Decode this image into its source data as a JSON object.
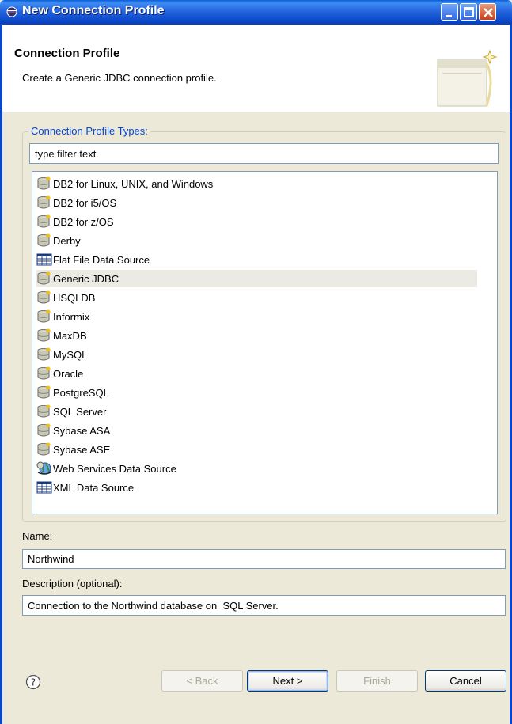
{
  "window": {
    "title": "New Connection Profile"
  },
  "banner": {
    "heading": "Connection Profile",
    "description": "Create a Generic JDBC connection profile."
  },
  "group": {
    "legend": "Connection Profile Types:",
    "filter_value": "type filter text",
    "items": [
      {
        "label": "DB2 for Linux, UNIX, and Windows",
        "icon": "database-icon"
      },
      {
        "label": "DB2 for i5/OS",
        "icon": "database-icon"
      },
      {
        "label": "DB2 for z/OS",
        "icon": "database-icon"
      },
      {
        "label": "Derby",
        "icon": "database-icon"
      },
      {
        "label": "Flat File Data Source",
        "icon": "table-icon"
      },
      {
        "label": "Generic JDBC",
        "icon": "database-icon",
        "selected": true
      },
      {
        "label": "HSQLDB",
        "icon": "database-icon"
      },
      {
        "label": "Informix",
        "icon": "database-icon"
      },
      {
        "label": "MaxDB",
        "icon": "database-icon"
      },
      {
        "label": "MySQL",
        "icon": "database-icon"
      },
      {
        "label": "Oracle",
        "icon": "database-icon"
      },
      {
        "label": "PostgreSQL",
        "icon": "database-icon"
      },
      {
        "label": "SQL Server",
        "icon": "database-icon"
      },
      {
        "label": "Sybase ASA",
        "icon": "database-icon"
      },
      {
        "label": "Sybase ASE",
        "icon": "database-icon"
      },
      {
        "label": "Web Services Data Source",
        "icon": "web-services-icon"
      },
      {
        "label": "XML Data Source",
        "icon": "table-icon"
      }
    ]
  },
  "form": {
    "name_label": "Name:",
    "name_value": "Northwind",
    "description_label": "Description (optional):",
    "description_value": "Connection to the Northwind database on  SQL Server."
  },
  "buttons": {
    "back": "< Back",
    "next": "Next >",
    "finish": "Finish",
    "cancel": "Cancel"
  },
  "colors": {
    "title_bar": "#2566e0",
    "legend_text": "#0046d5",
    "selected_row": "#ecebe3"
  }
}
